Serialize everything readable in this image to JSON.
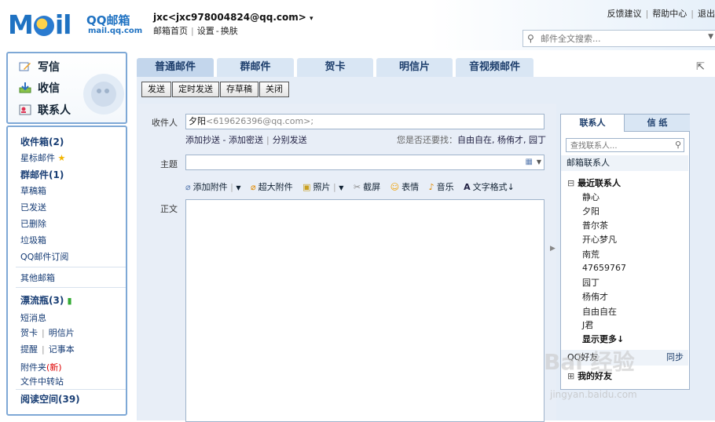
{
  "header": {
    "logo_big": "Mail",
    "logo_sub1": "QQ邮箱",
    "logo_sub2": "mail.qq.com",
    "user": "jxc<jxc978004824@qq.com>",
    "user_caret": "▾",
    "nav": [
      "邮箱首页",
      "设置",
      "换肤"
    ],
    "top_links": [
      "反馈建议",
      "帮助中心",
      "退出"
    ],
    "search_placeholder": "邮件全文搜索..."
  },
  "sidebar": {
    "quick": [
      "写信",
      "收信",
      "联系人"
    ],
    "inbox": "收件箱(2)",
    "starred": "星标邮件",
    "group": "群邮件(1)",
    "drafts": "草稿箱",
    "sent": "已发送",
    "deleted": "已删除",
    "spam": "垃圾箱",
    "subscribe": "QQ邮件订阅",
    "other": "其他邮箱",
    "bottle": "漂流瓶(3)",
    "sms": "短消息",
    "card": "贺卡",
    "postcard": "明信片",
    "remind": "提醒",
    "notes": "记事本",
    "attach": "附件夹",
    "attach_new": "(新)",
    "transfer": "文件中转站",
    "reading": "阅读空间(39)"
  },
  "tabs": [
    "普通邮件",
    "群邮件",
    "贺卡",
    "明信片",
    "音视频邮件"
  ],
  "toolbar": [
    "发送",
    "定时发送",
    "存草稿",
    "关闭"
  ],
  "compose": {
    "to_label": "收件人",
    "to_name": "夕阳",
    "to_addr": "<619626396@qq.com>;",
    "cc": "添加抄送",
    "bcc": "添加密送",
    "separate": "分别发送",
    "suggest_label": "您是否还要找：",
    "suggest_names": "自由自在, 杨侑才, 园丁",
    "subject_label": "主题",
    "body_label": "正文",
    "tools": [
      "添加附件",
      "超大附件",
      "照片",
      "截屏",
      "表情",
      "音乐",
      "文字格式"
    ]
  },
  "contacts": {
    "tab_contacts": "联系人",
    "tab_stationery": "信 纸",
    "search_placeholder": "查找联系人...",
    "mailbox_contacts": "邮箱联系人",
    "recent_title": "最近联系人",
    "recent": [
      "静心",
      "夕阳",
      "普尔茶",
      "开心梦凡",
      "南荒",
      "47659767",
      "园丁",
      "杨侑才",
      "自由自在",
      "J君"
    ],
    "more": "显示更多",
    "qq_friends": "QQ好友",
    "sync": "同步",
    "my_friends": "我的好友"
  },
  "watermark": "Bai 经验",
  "watermark_url": "jingyan.baidu.com"
}
